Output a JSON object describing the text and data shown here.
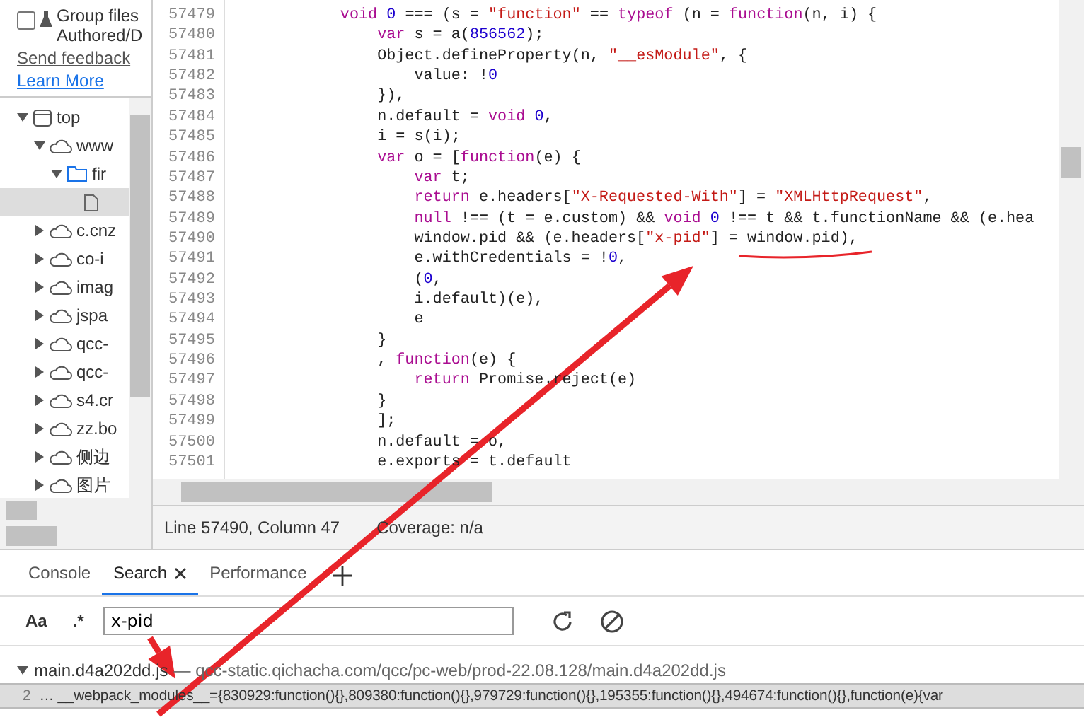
{
  "sidebar": {
    "group_files": {
      "label": "Group files Authored/D",
      "checked": false
    },
    "links": [
      {
        "label": "Send feedback",
        "kind": "feedback"
      },
      {
        "label": "Learn More",
        "kind": "learn"
      }
    ],
    "tree": [
      {
        "label": "top",
        "kind": "frame",
        "expanded": true,
        "selected": false,
        "children": [
          {
            "label": "www",
            "kind": "cloud",
            "expanded": true,
            "selected": false,
            "children": [
              {
                "label": "fir",
                "kind": "folder",
                "expanded": true,
                "selected": false,
                "children": [
                  {
                    "kind": "file",
                    "selected": true
                  }
                ]
              }
            ]
          },
          {
            "label": "c.cnz",
            "kind": "cloud",
            "expanded": false,
            "selected": false
          },
          {
            "label": "co-i",
            "kind": "cloud",
            "expanded": false,
            "selected": false
          },
          {
            "label": "imag",
            "kind": "cloud",
            "expanded": false,
            "selected": false
          },
          {
            "label": "jspa",
            "kind": "cloud",
            "expanded": false,
            "selected": false
          },
          {
            "label": "qcc-",
            "kind": "cloud",
            "expanded": false,
            "selected": false
          },
          {
            "label": "qcc-",
            "kind": "cloud",
            "expanded": false,
            "selected": false
          },
          {
            "label": "s4.cr",
            "kind": "cloud",
            "expanded": false,
            "selected": false
          },
          {
            "label": "zz.bo",
            "kind": "cloud",
            "expanded": false,
            "selected": false
          },
          {
            "label": "侧边",
            "kind": "cloud",
            "expanded": false,
            "selected": false
          },
          {
            "label": "图片",
            "kind": "cloud",
            "expanded": false,
            "selected": false
          }
        ]
      }
    ]
  },
  "editor": {
    "lines": [
      {
        "number": "57479",
        "tokens": [
          {
            "kind": "keyword",
            "text": "            void"
          },
          {
            "kind": "number",
            "text": " 0"
          },
          {
            "kind": "plain",
            "text": " === (s = "
          },
          {
            "kind": "string",
            "text": "\"function\""
          },
          {
            "kind": "plain",
            "text": " == "
          },
          {
            "kind": "keyword",
            "text": "typeof"
          },
          {
            "kind": "plain",
            "text": " (n = "
          },
          {
            "kind": "keyword",
            "text": "function"
          },
          {
            "kind": "plain",
            "text": "(n, i) {"
          }
        ]
      },
      {
        "number": "57480",
        "tokens": [
          {
            "kind": "keyword",
            "text": "                var"
          },
          {
            "kind": "plain",
            "text": " s = a("
          },
          {
            "kind": "number",
            "text": "856562"
          },
          {
            "kind": "plain",
            "text": ");"
          }
        ]
      },
      {
        "number": "57481",
        "tokens": [
          {
            "kind": "plain",
            "text": "                Object.defineProperty(n, "
          },
          {
            "kind": "string",
            "text": "\"__esModule\""
          },
          {
            "kind": "plain",
            "text": ", {"
          }
        ]
      },
      {
        "number": "57482",
        "tokens": [
          {
            "kind": "plain",
            "text": "                    value: !"
          },
          {
            "kind": "number",
            "text": "0"
          }
        ]
      },
      {
        "number": "57483",
        "tokens": [
          {
            "kind": "plain",
            "text": "                }),"
          }
        ]
      },
      {
        "number": "57484",
        "tokens": [
          {
            "kind": "plain",
            "text": "                n.default = "
          },
          {
            "kind": "keyword",
            "text": "void"
          },
          {
            "kind": "number",
            "text": " 0"
          },
          {
            "kind": "plain",
            "text": ","
          }
        ]
      },
      {
        "number": "57485",
        "tokens": [
          {
            "kind": "plain",
            "text": "                i = s(i);"
          }
        ]
      },
      {
        "number": "57486",
        "tokens": [
          {
            "kind": "keyword",
            "text": "                var"
          },
          {
            "kind": "plain",
            "text": " o = ["
          },
          {
            "kind": "keyword",
            "text": "function"
          },
          {
            "kind": "plain",
            "text": "(e) {"
          }
        ]
      },
      {
        "number": "57487",
        "tokens": [
          {
            "kind": "keyword",
            "text": "                    var"
          },
          {
            "kind": "plain",
            "text": " t;"
          }
        ]
      },
      {
        "number": "57488",
        "tokens": [
          {
            "kind": "keyword",
            "text": "                    return"
          },
          {
            "kind": "plain",
            "text": " e.headers["
          },
          {
            "kind": "string",
            "text": "\"X-Requested-With\""
          },
          {
            "kind": "plain",
            "text": "] = "
          },
          {
            "kind": "string",
            "text": "\"XMLHttpRequest\""
          },
          {
            "kind": "plain",
            "text": ","
          }
        ]
      },
      {
        "number": "57489",
        "tokens": [
          {
            "kind": "keyword",
            "text": "                    null"
          },
          {
            "kind": "plain",
            "text": " !== (t = e.custom) && "
          },
          {
            "kind": "keyword",
            "text": "void"
          },
          {
            "kind": "number",
            "text": " 0"
          },
          {
            "kind": "plain",
            "text": " !== t && t.functionName && (e.hea"
          }
        ]
      },
      {
        "number": "57490",
        "tokens": [
          {
            "kind": "plain",
            "text": "                    window.pid && (e.headers["
          },
          {
            "kind": "string",
            "text": "\"x-pid\""
          },
          {
            "kind": "plain",
            "text": "] = window.pid),"
          }
        ]
      },
      {
        "number": "57491",
        "tokens": [
          {
            "kind": "plain",
            "text": "                    e.withCredentials = !"
          },
          {
            "kind": "number",
            "text": "0"
          },
          {
            "kind": "plain",
            "text": ","
          }
        ]
      },
      {
        "number": "57492",
        "tokens": [
          {
            "kind": "plain",
            "text": "                    ("
          },
          {
            "kind": "number",
            "text": "0"
          },
          {
            "kind": "plain",
            "text": ","
          }
        ]
      },
      {
        "number": "57493",
        "tokens": [
          {
            "kind": "plain",
            "text": "                    i.default)(e),"
          }
        ]
      },
      {
        "number": "57494",
        "tokens": [
          {
            "kind": "plain",
            "text": "                    e"
          }
        ]
      },
      {
        "number": "57495",
        "tokens": [
          {
            "kind": "plain",
            "text": "                }"
          }
        ]
      },
      {
        "number": "57496",
        "tokens": [
          {
            "kind": "plain",
            "text": "                , "
          },
          {
            "kind": "keyword",
            "text": "function"
          },
          {
            "kind": "plain",
            "text": "(e) {"
          }
        ]
      },
      {
        "number": "57497",
        "tokens": [
          {
            "kind": "keyword",
            "text": "                    return"
          },
          {
            "kind": "plain",
            "text": " Promise.reject(e)"
          }
        ]
      },
      {
        "number": "57498",
        "tokens": [
          {
            "kind": "plain",
            "text": "                }"
          }
        ]
      },
      {
        "number": "57499",
        "tokens": [
          {
            "kind": "plain",
            "text": "                ];"
          }
        ]
      },
      {
        "number": "57500",
        "tokens": [
          {
            "kind": "plain",
            "text": "                n.default = o,"
          }
        ]
      },
      {
        "number": "57501",
        "tokens": [
          {
            "kind": "plain",
            "text": "                e.exports = t.default"
          }
        ]
      }
    ]
  },
  "status_bar": {
    "position": "Line 57490, Column 47",
    "coverage": "Coverage: n/a"
  },
  "drawer_tabs": [
    {
      "label": "Console",
      "selected": false,
      "closable": false
    },
    {
      "label": "Search",
      "selected": true,
      "closable": true
    },
    {
      "label": "Performance",
      "selected": false,
      "closable": false
    }
  ],
  "search": {
    "match_case": "Aa",
    "regex": ".*",
    "value": "x-pid"
  },
  "results": [
    {
      "file": "main.d4a202dd.js",
      "url": "— qcc-static.qichacha.com/qcc/pc-web/prod-22.08.128/main.d4a202dd.js",
      "expanded": true,
      "matches": [
        {
          "line": "2",
          "text": "… __webpack_modules__={830929:function(){},809380:function(){},979729:function(){},195355:function(){},494674:function(){},function(e){var",
          "selected": true
        }
      ]
    }
  ]
}
